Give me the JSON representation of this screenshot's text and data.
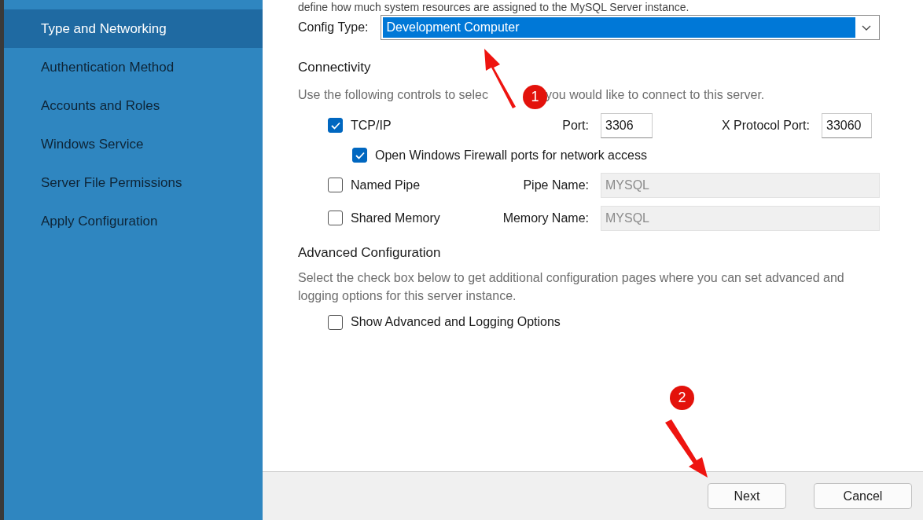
{
  "sidebar": {
    "items": [
      {
        "label": "Type and Networking",
        "selected": true
      },
      {
        "label": "Authentication Method",
        "selected": false
      },
      {
        "label": "Accounts and Roles",
        "selected": false
      },
      {
        "label": "Windows Service",
        "selected": false
      },
      {
        "label": "Server File Permissions",
        "selected": false
      },
      {
        "label": "Apply Configuration",
        "selected": false
      }
    ]
  },
  "intro": "define how much system resources are assigned to the MySQL Server instance.",
  "config_type": {
    "label": "Config Type:",
    "value": "Development Computer"
  },
  "connectivity": {
    "heading": "Connectivity",
    "description_parts": [
      "Use the following controls to selec",
      "you would like to connect to this server."
    ],
    "rows": [
      {
        "kind": "option",
        "label": "TCP/IP",
        "checked": true,
        "fields": [
          {
            "label": "Port:",
            "value": "3306",
            "disabled": false
          },
          {
            "label": "X Protocol Port:",
            "value": "33060",
            "disabled": false
          }
        ]
      },
      {
        "kind": "suboption",
        "label": "Open Windows Firewall ports for network access",
        "checked": true
      },
      {
        "kind": "option",
        "label": "Named Pipe",
        "checked": false,
        "fields": [
          {
            "label": "Pipe Name:",
            "value": "MYSQL",
            "disabled": true
          }
        ]
      },
      {
        "kind": "option",
        "label": "Shared Memory",
        "checked": false,
        "fields": [
          {
            "label": "Memory Name:",
            "value": "MYSQL",
            "disabled": true
          }
        ]
      }
    ]
  },
  "advanced": {
    "heading": "Advanced Configuration",
    "description": "Select the check box below to get additional configuration pages where you can set advanced and logging options for this server instance.",
    "option": {
      "label": "Show Advanced and Logging Options",
      "checked": false
    }
  },
  "buttons": [
    {
      "label": "Next"
    },
    {
      "label": "Cancel"
    }
  ],
  "annotations": [
    {
      "number": "1"
    },
    {
      "number": "2"
    }
  ]
}
